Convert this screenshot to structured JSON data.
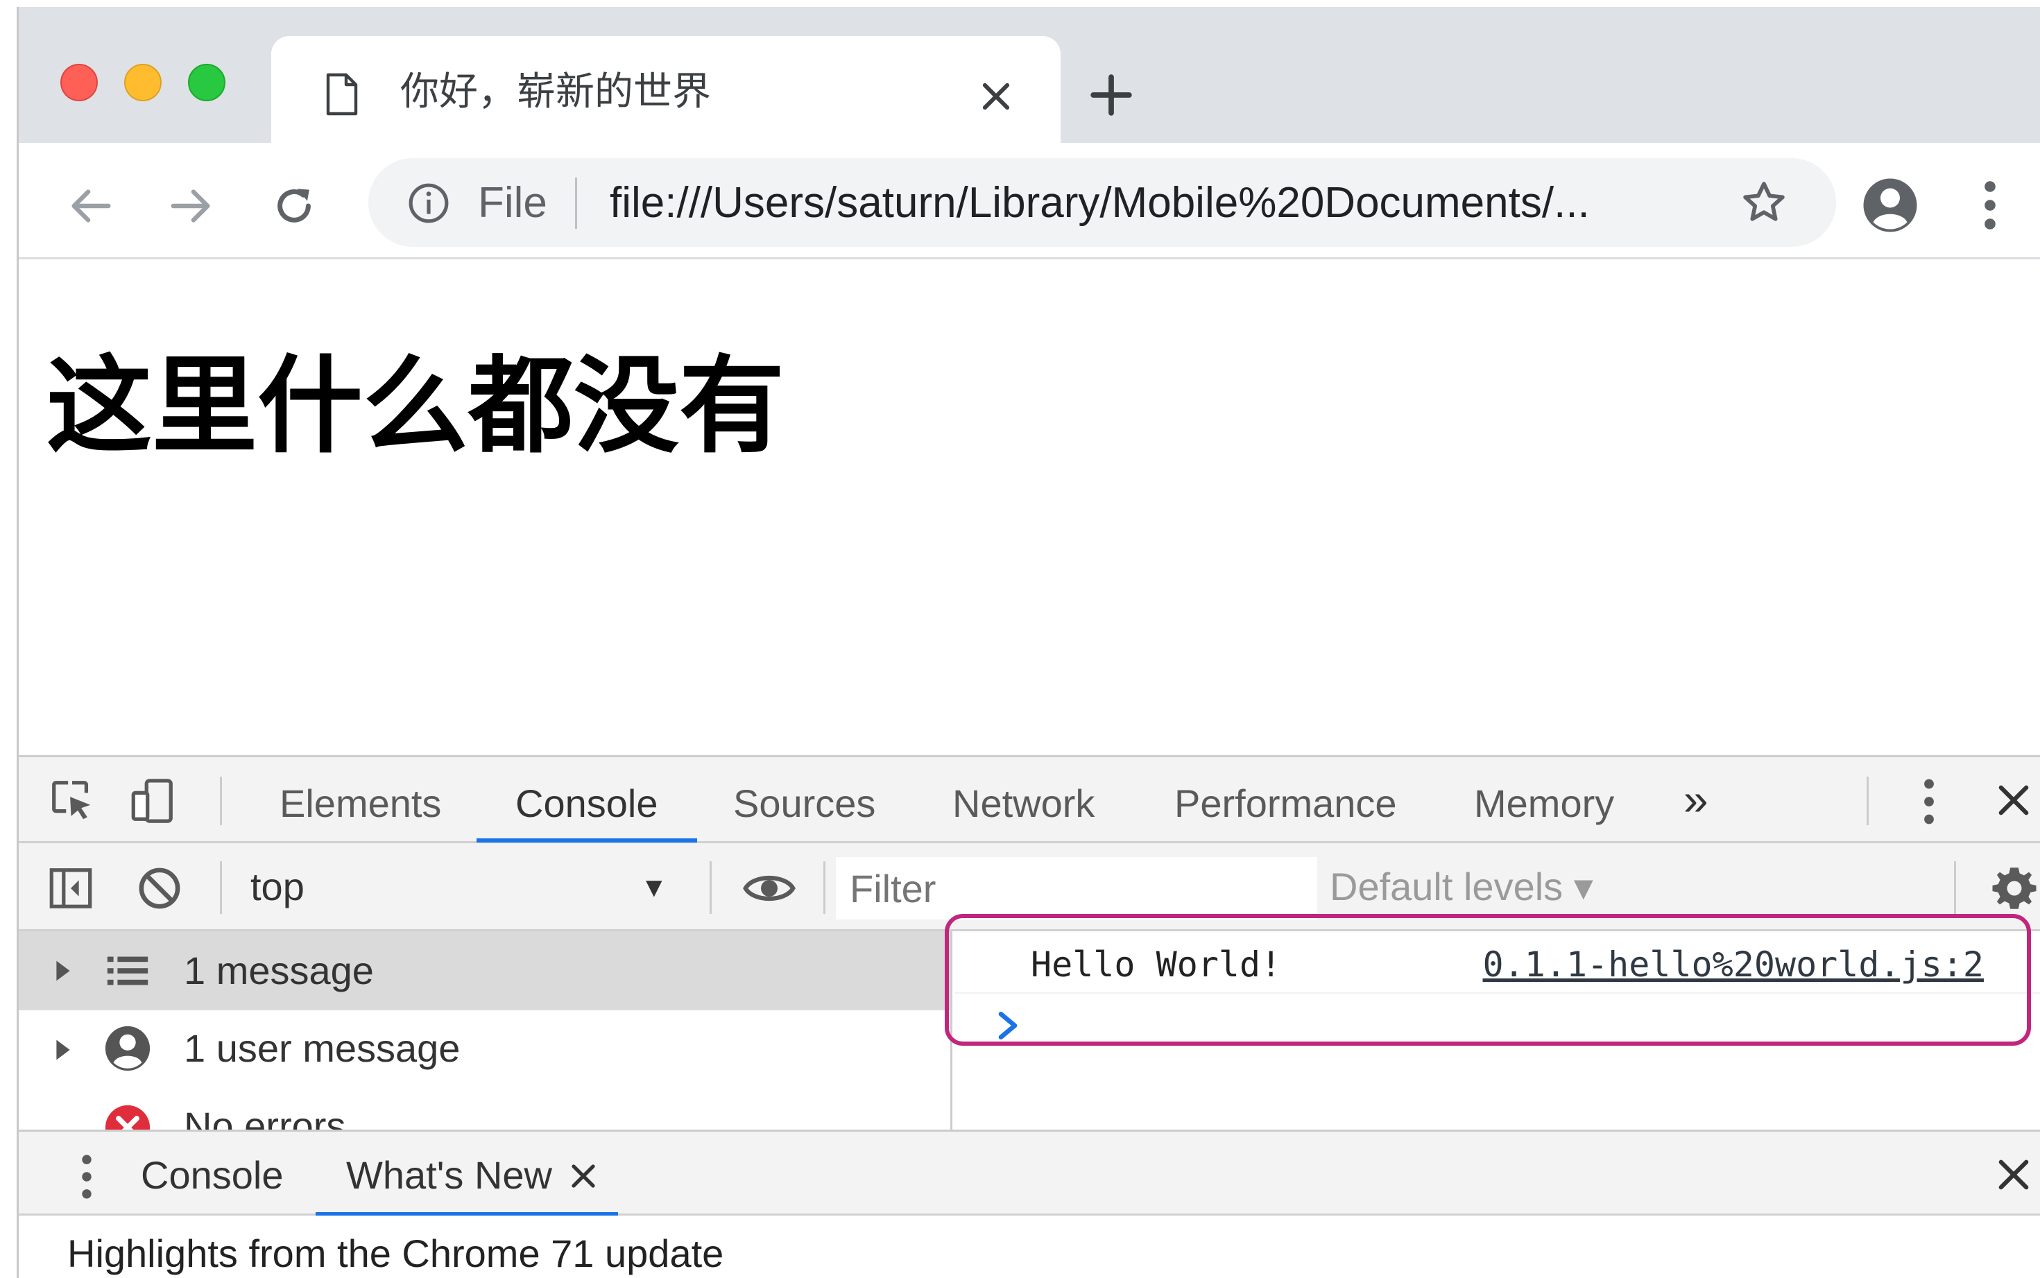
{
  "browser": {
    "tab": {
      "title": "你好，崭新的世界",
      "icon": "document-icon"
    },
    "omnibox": {
      "scheme_label": "File",
      "url": "file:///Users/saturn/Library/Mobile%20Documents/..."
    }
  },
  "page": {
    "heading": "这里什么都没有"
  },
  "devtools": {
    "tabs": [
      "Elements",
      "Console",
      "Sources",
      "Network",
      "Performance",
      "Memory"
    ],
    "active_tab": "Console",
    "more_tabs_label": "»",
    "console_toolbar": {
      "context": "top",
      "filter_placeholder": "Filter",
      "levels": "Default levels ▾"
    },
    "sidebar": [
      {
        "label": "1 message",
        "icon": "list-icon"
      },
      {
        "label": "1 user message",
        "icon": "user-icon"
      },
      {
        "label": "No errors",
        "icon": "error-icon"
      }
    ],
    "messages": [
      {
        "text": "Hello World!",
        "source": "0.1.1-hello%20world.js:2"
      }
    ],
    "drawer": {
      "tabs": [
        "Console",
        "What's New"
      ],
      "active_tab": "What's New",
      "content_title": "Highlights from the Chrome 71 update"
    }
  },
  "colors": {
    "accent": "#1a73e8",
    "annotation_frame": "#c0267d",
    "error": "#e02d3c"
  }
}
